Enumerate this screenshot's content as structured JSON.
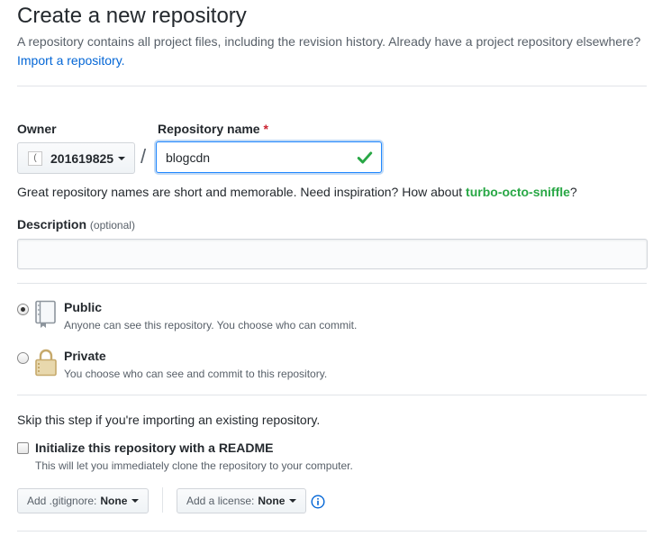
{
  "header": {
    "title": "Create a new repository",
    "subtitle": "A repository contains all project files, including the revision history. Already have a project repository elsewhere?",
    "import_link": "Import a repository."
  },
  "owner": {
    "label": "Owner",
    "value": "201619825",
    "avatar_alt": "("
  },
  "repo": {
    "label": "Repository name",
    "required_mark": "*",
    "value": "blogcdn",
    "separator": "/",
    "valid": true,
    "valid_color": "#28a745"
  },
  "hint": {
    "text": "Great repository names are short and memorable. Need inspiration? How about",
    "suggestion": "turbo-octo-sniffle",
    "end": "?"
  },
  "description": {
    "label": "Description",
    "optional": "(optional)",
    "value": ""
  },
  "visibility": {
    "selected": "public",
    "options": [
      {
        "id": "public",
        "title": "Public",
        "note": "Anyone can see this repository. You choose who can commit.",
        "icon": "repo-book-icon"
      },
      {
        "id": "private",
        "title": "Private",
        "note": "You choose who can see and commit to this repository.",
        "icon": "lock-icon"
      }
    ]
  },
  "init": {
    "skip_text": "Skip this step if you're importing an existing repository.",
    "readme_label": "Initialize this repository with a README",
    "readme_note": "This will let you immediately clone the repository to your computer.",
    "readme_checked": false
  },
  "selects": {
    "gitignore_prefix": "Add .gitignore:",
    "gitignore_value": "None",
    "license_prefix": "Add a license:",
    "license_value": "None",
    "info_icon": "info-icon"
  },
  "colors": {
    "link": "#0366d6",
    "suggestion": "#28a745",
    "required": "#cb2431",
    "focus_border": "#2188ff",
    "icon_lock": "#c6a96b"
  }
}
